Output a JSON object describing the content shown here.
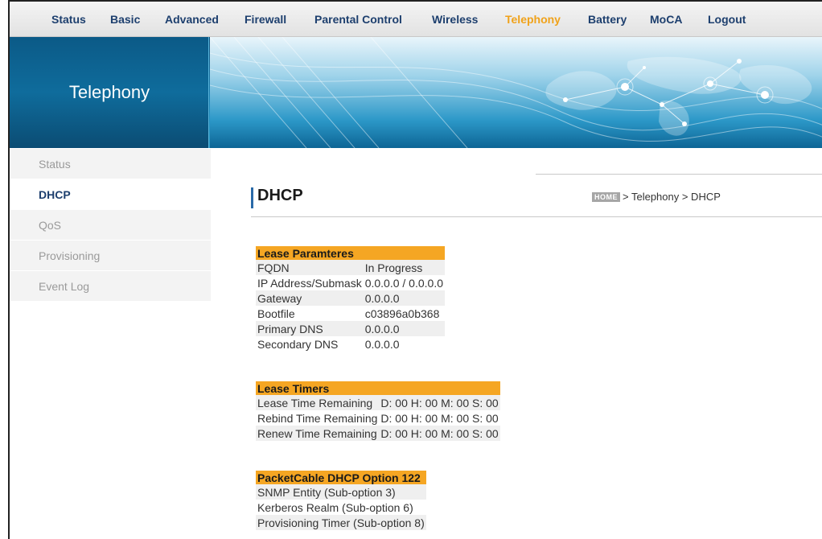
{
  "nav": {
    "items": [
      "Status",
      "Basic",
      "Advanced",
      "Firewall",
      "Parental Control",
      "Wireless",
      "Telephony",
      "Battery",
      "MoCA",
      "Logout"
    ],
    "active": "Telephony"
  },
  "banner": {
    "title": "Telephony"
  },
  "sidebar": {
    "items": [
      "Status",
      "DHCP",
      "QoS",
      "Provisioning",
      "Event Log"
    ],
    "active": "DHCP"
  },
  "page": {
    "title": "DHCP",
    "breadcrumb": {
      "home": "HOME",
      "path": "> Telephony > DHCP"
    }
  },
  "lease_parameters": {
    "header": "Lease Paramteres",
    "rows": [
      {
        "label": "FQDN",
        "value": "In Progress"
      },
      {
        "label": "IP Address/Submask",
        "value": "0.0.0.0 / 0.0.0.0"
      },
      {
        "label": "Gateway",
        "value": "0.0.0.0"
      },
      {
        "label": "Bootfile",
        "value": "c03896a0b368"
      },
      {
        "label": "Primary DNS",
        "value": "0.0.0.0"
      },
      {
        "label": "Secondary DNS",
        "value": "0.0.0.0"
      }
    ]
  },
  "lease_timers": {
    "header": "Lease Timers",
    "rows": [
      {
        "label": "Lease Time Remaining",
        "value": "D: 00 H: 00 M: 00 S: 00"
      },
      {
        "label": "Rebind Time Remaining",
        "value": "D: 00 H: 00 M: 00 S: 00"
      },
      {
        "label": "Renew Time Remaining",
        "value": "D: 00 H: 00 M: 00 S: 00"
      }
    ]
  },
  "option122": {
    "header": "PacketCable DHCP Option 122",
    "rows": [
      {
        "label": "SNMP Entity (Sub-option 3)",
        "value": ""
      },
      {
        "label": "Kerberos Realm (Sub-option 6)",
        "value": ""
      },
      {
        "label": "Provisioning Timer (Sub-option 8)",
        "value": ""
      }
    ]
  },
  "colors": {
    "nav_text": "#1d3f6e",
    "nav_active": "#f0a21a",
    "table_header": "#f5a623",
    "banner_blue": "#0f6c9c"
  }
}
